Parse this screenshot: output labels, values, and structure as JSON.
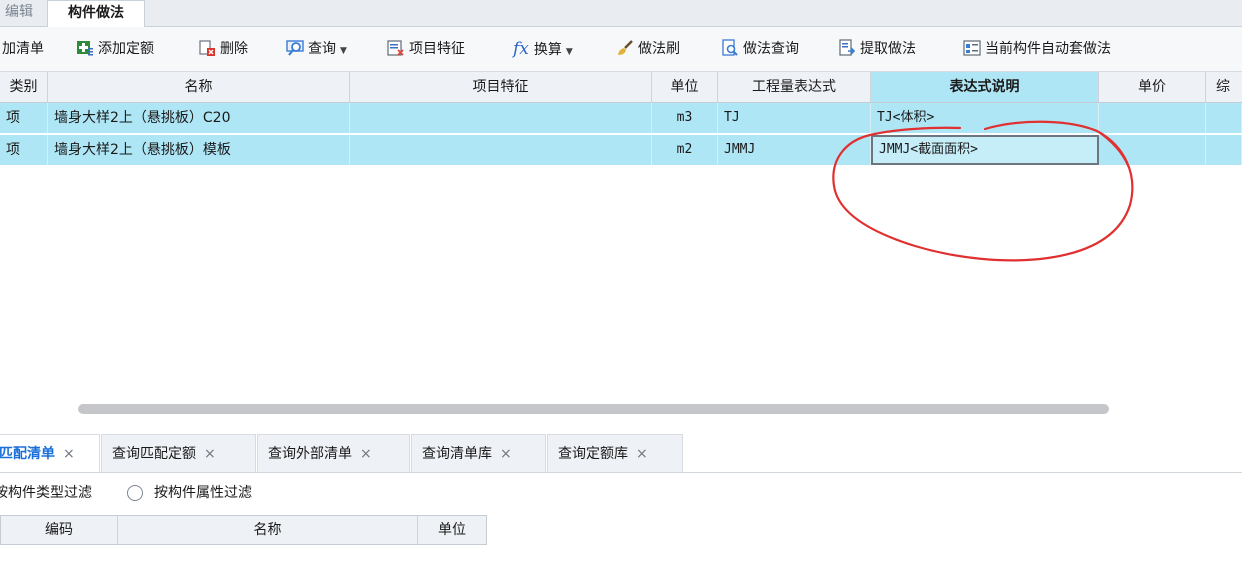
{
  "top_tabs": {
    "inactive": "编辑",
    "active": "构件做法"
  },
  "toolbar": {
    "add_list": "加清单",
    "add_quota": "添加定额",
    "delete": "删除",
    "query": "查询",
    "item_feature": "项目特征",
    "convert": "换算",
    "method_brush": "做法刷",
    "method_query": "做法查询",
    "extract_method": "提取做法",
    "auto_apply": "当前构件自动套做法",
    "fx_symbol": "fx"
  },
  "grid": {
    "headers": [
      "类别",
      "名称",
      "项目特征",
      "单位",
      "工程量表达式",
      "表达式说明",
      "单价",
      "综"
    ],
    "rows": [
      {
        "category": "项",
        "name": "墙身大样2上（悬挑板）C20",
        "feature": "",
        "unit": "m3",
        "expression": "TJ",
        "description": "TJ<体积>"
      },
      {
        "category": "项",
        "name": "墙身大样2上（悬挑板）模板",
        "feature": "",
        "unit": "m2",
        "expression": "JMMJ",
        "description": "JMMJ<截面面积>"
      }
    ]
  },
  "bottom_tabs": [
    {
      "label": "匹配清单",
      "close": "×"
    },
    {
      "label": "查询匹配定额",
      "close": "×"
    },
    {
      "label": "查询外部清单",
      "close": "×"
    },
    {
      "label": "查询清单库",
      "close": "×"
    },
    {
      "label": "查询定额库",
      "close": "×"
    }
  ],
  "filters": {
    "by_type": "按构件类型过滤",
    "by_attr": "按构件属性过滤"
  },
  "sub_table": {
    "headers": [
      "编码",
      "名称",
      "单位"
    ]
  },
  "colors": {
    "selection": "#aee6f6",
    "accent": "#1a6fdc",
    "annotation": "#e03030"
  }
}
